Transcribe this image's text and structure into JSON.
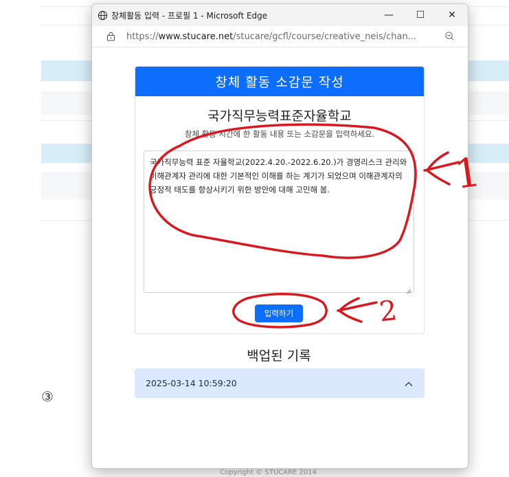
{
  "background": {
    "marker": "③",
    "footer": "Copyright © STUCARE 2014"
  },
  "window": {
    "title": "창체활동 입력 - 프로필 1 - Microsoft Edge",
    "controls": {
      "minimize": "—",
      "maximize": "☐",
      "close": "✕"
    },
    "url_prefix": "https://",
    "url_domain": "www.stucare.net",
    "url_path": "/stucare/gcfl/course/creative_neis/chan..."
  },
  "card": {
    "header": "창체 활동 소감문 작성",
    "school_name": "국가직무능력표준자율학교",
    "instruction": "창체 활동 시간에 한 활동 내용 또는 소감문을 입력하세요.",
    "textarea_value": "국가직무능력 표준 자율학교(2022.4.20.-2022.6.20.)가 경영리스크 관리와 이해관계자 관리에 대한 기본적인 이해를 하는 계기가 되었으며 이해관계자의 긍정적 태도를 향상시키기 위한 방안에 대해 고민해 봄.",
    "submit_label": "입력하기"
  },
  "backup": {
    "title": "백업된 기록",
    "items": [
      {
        "timestamp": "2025-03-14 10:59:20"
      }
    ]
  },
  "annotations": {
    "label1": "1",
    "label2": "2",
    "color": "#d8191f"
  },
  "colors": {
    "primary": "#0d6efd",
    "accordion_bg": "#dbe8fd"
  }
}
